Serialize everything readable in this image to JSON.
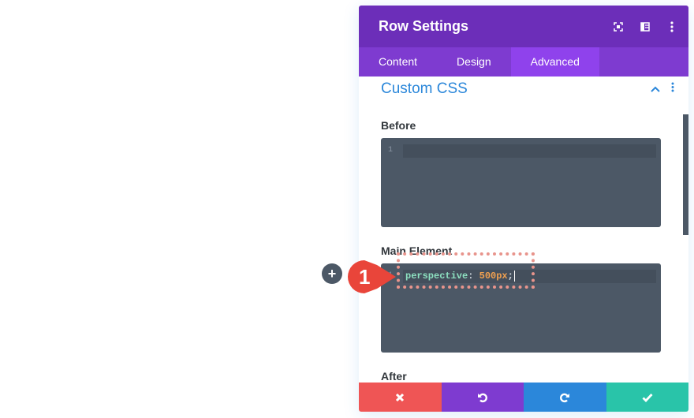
{
  "panel": {
    "title": "Row Settings",
    "header_icons": [
      "fullscreen-icon",
      "split-view-icon",
      "more-options-icon"
    ]
  },
  "tabs": [
    {
      "label": "Content",
      "active": false
    },
    {
      "label": "Design",
      "active": false
    },
    {
      "label": "Advanced",
      "active": true
    }
  ],
  "section": {
    "title": "Custom CSS",
    "expanded": true
  },
  "fields": {
    "before": {
      "label": "Before",
      "line_number": "1",
      "code": ""
    },
    "main": {
      "label": "Main Element",
      "line_number": "1",
      "property": "perspective",
      "colon": ":",
      "value": "500px",
      "semicolon": ";"
    },
    "after": {
      "label": "After"
    }
  },
  "annotation": {
    "step": "1"
  },
  "footer": {
    "buttons": [
      {
        "name": "cancel",
        "color": "#ef5555"
      },
      {
        "name": "undo",
        "color": "#7e3bd0"
      },
      {
        "name": "redo",
        "color": "#2b87da"
      },
      {
        "name": "save",
        "color": "#29c4a9"
      }
    ]
  },
  "colors": {
    "header": "#6c2eb9",
    "tabs": "#7e3bd0",
    "active_tab": "#8f42ec",
    "section_title": "#2b87da",
    "editor_bg": "#4c5866"
  }
}
